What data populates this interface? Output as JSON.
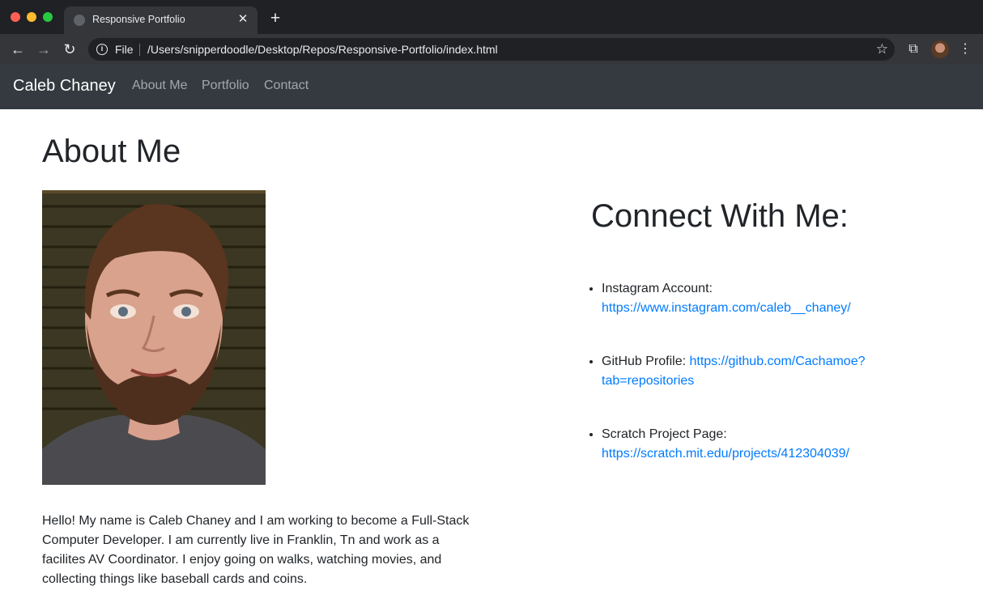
{
  "browser": {
    "tab_title": "Responsive Portfolio",
    "close_glyph": "✕",
    "new_tab_glyph": "+",
    "back_glyph": "←",
    "forward_glyph": "→",
    "reload_glyph": "↻",
    "info_glyph": "i",
    "scheme": "File",
    "url": "/Users/snipperdoodle/Desktop/Repos/Responsive-Portfolio/index.html",
    "bookmark_glyph": "☆",
    "extensions_glyph": "⧉",
    "menu_glyph": "⋮"
  },
  "site": {
    "brand": "Caleb Chaney",
    "nav": [
      "About Me",
      "Portfolio",
      "Contact"
    ]
  },
  "about": {
    "heading": "About Me",
    "bio": "Hello! My name is Caleb Chaney and I am working to become a Full-Stack Computer Developer. I am currently live in Franklin, Tn and work as a facilites AV Coordinator. I enjoy going on walks, watching movies, and collecting things like baseball cards and coins."
  },
  "connect": {
    "heading": "Connect With Me:",
    "items": [
      {
        "label": "Instagram Account:",
        "link": "https://www.instagram.com/caleb__chaney/"
      },
      {
        "label": "GitHub Profile:",
        "link": "https://github.com/Cachamoe?tab=repositories"
      },
      {
        "label": "Scratch Project Page:",
        "link": "https://scratch.mit.edu/projects/412304039/"
      }
    ]
  },
  "colors": {
    "navbar": "#343a40",
    "link": "#007bff",
    "text": "#212529"
  }
}
